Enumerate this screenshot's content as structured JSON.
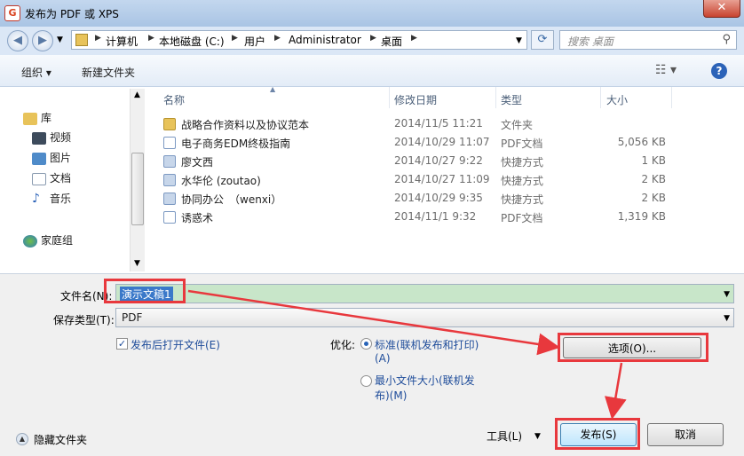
{
  "window": {
    "title": "发布为 PDF 或 XPS",
    "close_glyph": "✕"
  },
  "nav": {
    "back_glyph": "◀",
    "forward_glyph": "▶",
    "breadcrumbs": [
      "计算机",
      "本地磁盘 (C:)",
      "用户",
      "Administrator",
      "桌面"
    ],
    "search_placeholder": "搜索 桌面"
  },
  "toolbar": {
    "organize_label": "组织 ▾",
    "new_folder_label": "新建文件夹"
  },
  "sidebar": {
    "library_label": "库",
    "items": [
      {
        "label": "视频",
        "icon": "video-icon"
      },
      {
        "label": "图片",
        "icon": "picture-icon"
      },
      {
        "label": "文档",
        "icon": "document-icon"
      },
      {
        "label": "音乐",
        "icon": "music-icon"
      }
    ],
    "homegroup_label": "家庭组"
  },
  "filelist": {
    "columns": [
      "名称",
      "修改日期",
      "类型",
      "大小"
    ],
    "rows": [
      {
        "name": "战略合作资料以及协议范本",
        "date": "2014/11/5 11:21",
        "type": "文件夹",
        "size": "",
        "icon": "folder-icon"
      },
      {
        "name": "电子商务EDM终极指南",
        "date": "2014/10/29 11:07",
        "type": "PDF文档",
        "size": "5,056 KB",
        "icon": "pdf-icon"
      },
      {
        "name": "廖文西",
        "date": "2014/10/27 9:22",
        "type": "快捷方式",
        "size": "1 KB",
        "icon": "shortcut-icon"
      },
      {
        "name": "水华伦 (zoutao)",
        "date": "2014/10/27 11:09",
        "type": "快捷方式",
        "size": "2 KB",
        "icon": "shortcut-icon"
      },
      {
        "name": "协同办公　（wenxi）",
        "date": "2014/10/29 9:35",
        "type": "快捷方式",
        "size": "2 KB",
        "icon": "shortcut-icon"
      },
      {
        "name": "诱惑术",
        "date": "2014/11/1 9:32",
        "type": "PDF文档",
        "size": "1,319 KB",
        "icon": "pdf-icon"
      }
    ]
  },
  "form": {
    "filename_label": "文件名(N):",
    "filename_value": "演示文稿1",
    "savetype_label": "保存类型(T):",
    "savetype_value": "PDF",
    "open_after_label": "发布后打开文件(E)",
    "optimize_label": "优化:",
    "opt_standard_label": "标准(联机发布和打印)",
    "opt_standard_sub": "(A)",
    "opt_min_label": "最小文件大小(联机发",
    "opt_min_sub": "布)(M)",
    "options_button": "选项(O)...",
    "tools_label": "工具(L)",
    "publish_button": "发布(S)",
    "cancel_button": "取消",
    "hide_folders_label": "隐藏文件夹"
  },
  "colors": {
    "annotation": "#e8383d",
    "filename_bg": "#c8e6c9"
  }
}
